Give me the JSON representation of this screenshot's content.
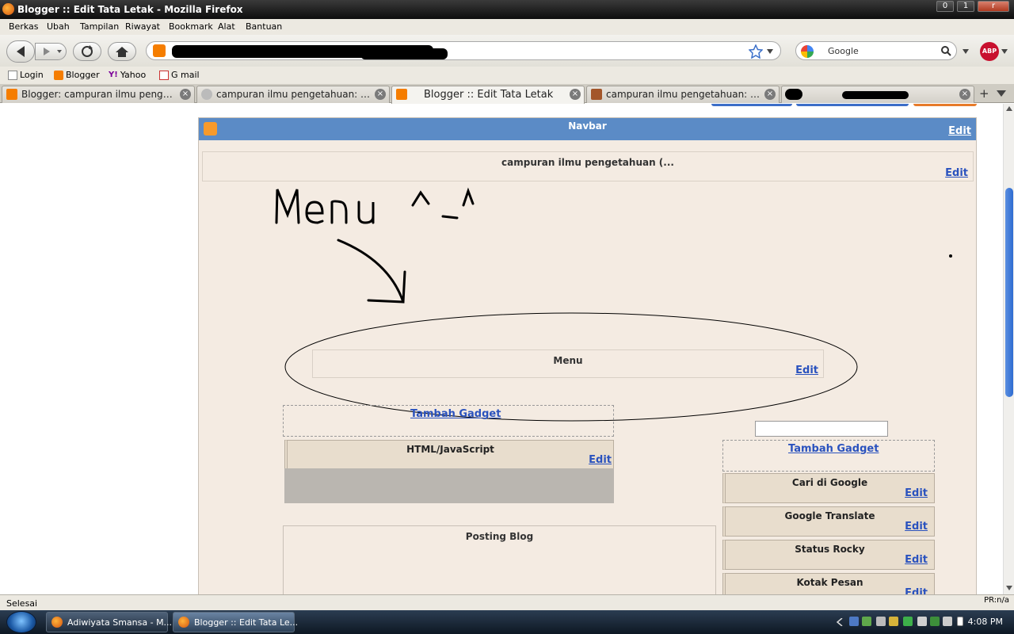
{
  "window": {
    "title": "Blogger :: Edit Tata Letak - Mozilla Firefox",
    "min": "0",
    "max": "1",
    "close": "r"
  },
  "menu": [
    "Berkas",
    "Ubah",
    "Tampilan",
    "Riwayat",
    "Bookmark",
    "Alat",
    "Bantuan"
  ],
  "search": {
    "engine_text": "Google"
  },
  "adblock_label": "ABP",
  "bookmarks": [
    "Login",
    "Blogger",
    "Yahoo",
    "G mail"
  ],
  "yahoo_prefix": "Y!",
  "tabs": [
    {
      "label": "Blogger: campuran ilmu pengetah...",
      "icon_color": "#f57d00"
    },
    {
      "label": "campuran ilmu pengetahuan: Siap...",
      "icon_color": "#bbbbbb"
    },
    {
      "label": "Blogger :: Edit Tata Letak",
      "icon_color": "#f57d00"
    },
    {
      "label": "campuran ilmu pengetahuan: Siap...",
      "icon_color": "#a3562a"
    }
  ],
  "tab_close_glyph": "×",
  "new_tab_glyph": "+",
  "page": {
    "navbar_title": "Navbar",
    "navbar_edit": "Edit",
    "header_title": "campuran ilmu pengetahuan (...",
    "header_edit": "Edit",
    "annotation": "Menu ^_^",
    "menu_title": "Menu",
    "menu_edit": "Edit",
    "add_gadget_left": "Tambah Gadget",
    "html_js_title": "HTML/JavaScript",
    "html_js_edit": "Edit",
    "posting_title": "Posting Blog",
    "add_gadget_right": "Tambah Gadget",
    "sidebar_widgets": [
      {
        "title": "Cari di Google",
        "edit": "Edit"
      },
      {
        "title": "Google Translate",
        "edit": "Edit"
      },
      {
        "title": "Status Rocky",
        "edit": "Edit"
      },
      {
        "title": "Kotak Pesan",
        "edit": "Edit"
      }
    ]
  },
  "status": {
    "text": "Selesai",
    "pr": "PR:n/a"
  },
  "taskbar": {
    "tasks": [
      "Adiwiyata Smansa - M...",
      "Blogger :: Edit Tata Le..."
    ],
    "clock": "4:08 PM"
  },
  "colors": {
    "navbar_blue": "#5b8bc6",
    "layout_bg": "#f4ebe2",
    "link": "#2a52be"
  }
}
